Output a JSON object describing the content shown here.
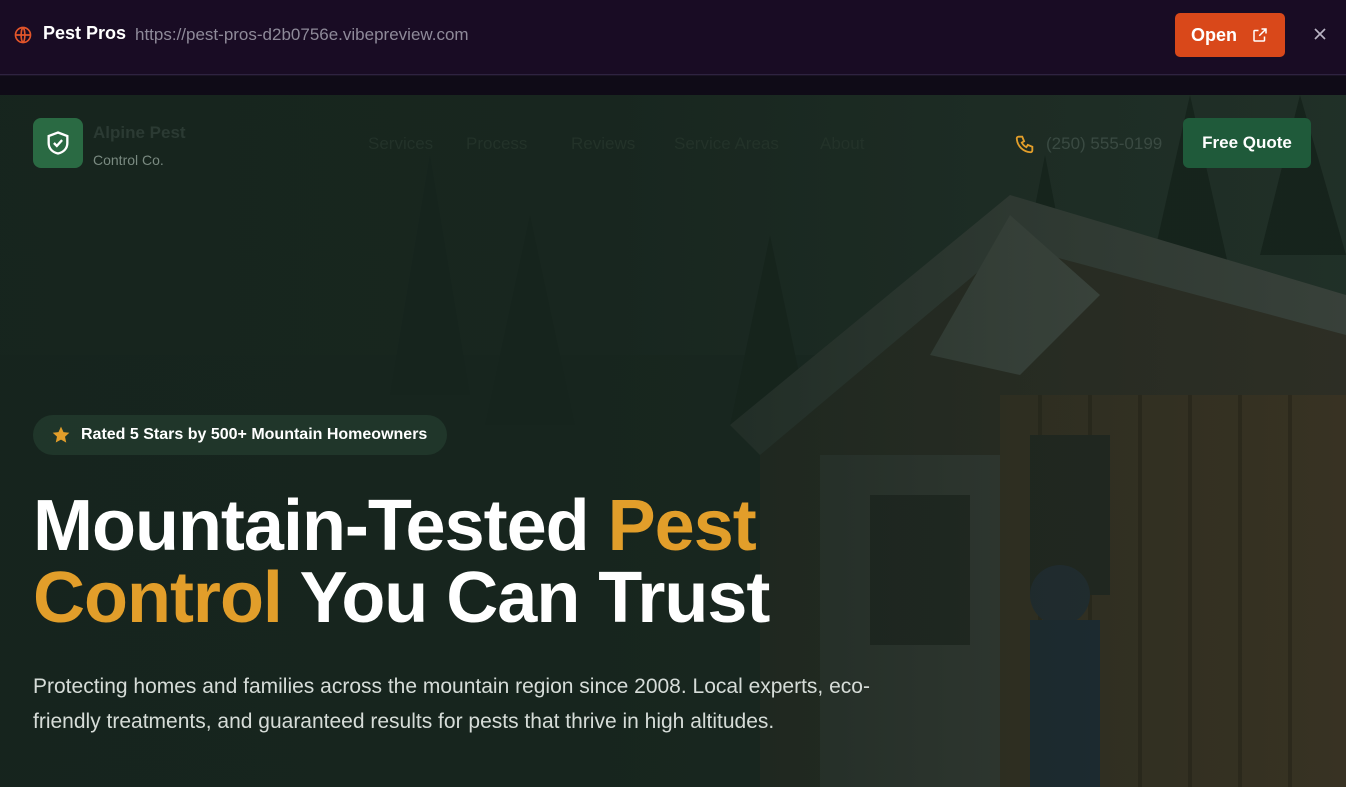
{
  "preview_bar": {
    "site_name": "Pest Pros",
    "url": "https://pest-pros-d2b0756e.vibepreview.com",
    "open_label": "Open",
    "icons": {
      "globe": "globe-icon",
      "external": "external-link-icon",
      "close": "close-icon"
    },
    "accent_color": "#d9481a"
  },
  "site": {
    "logo_name": "Alpine Pest",
    "logo_sub": "Control Co.",
    "nav": [
      "Services",
      "Process",
      "Reviews",
      "Service Areas",
      "About"
    ],
    "phone": "(250) 555-0199",
    "cta": "Free Quote",
    "brand_color": "#1f5a3a"
  },
  "hero": {
    "badge": "Rated 5 Stars by 500+ Mountain Homeowners",
    "headline_1": "Mountain-Tested ",
    "headline_accent_1": "Pest",
    "headline_accent_2": "Control",
    "headline_2": " You Can Trust",
    "subtext": "Protecting homes and families across the mountain region since 2008. Local experts, eco-friendly treatments, and guaranteed results for pests that thrive in high altitudes.",
    "accent_color": "#e29e2a"
  }
}
